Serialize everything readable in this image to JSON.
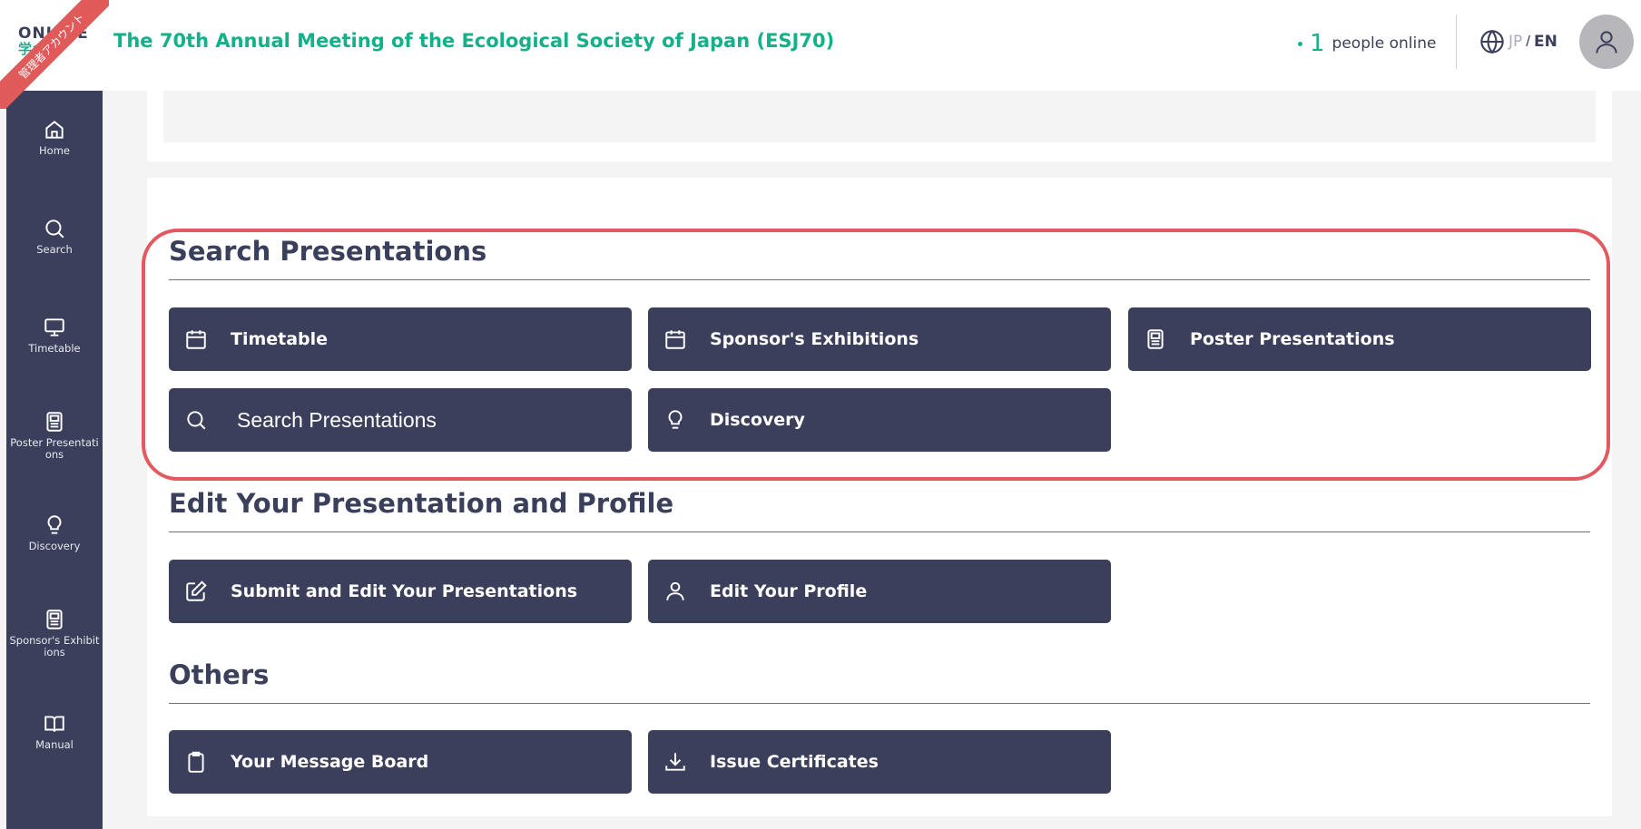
{
  "header": {
    "logo_line1": "ONLINE",
    "logo_line2": "学会",
    "ribbon": "管理者アカウント",
    "title": "The 70th Annual Meeting of the Ecological Society of Japan (ESJ70)",
    "online_count": "1",
    "online_label": "people online",
    "lang_jp": "JP",
    "lang_sep": "/",
    "lang_en": "EN"
  },
  "sidebar": {
    "items": [
      {
        "label": "Home",
        "icon": "home-icon"
      },
      {
        "label": "Search",
        "icon": "search-icon"
      },
      {
        "label": "Timetable",
        "icon": "monitor-icon"
      },
      {
        "label": "Poster Presentations",
        "icon": "poster-icon"
      },
      {
        "label": "Discovery",
        "icon": "lightbulb-icon"
      },
      {
        "label": "Sponsor's Exhibitions",
        "icon": "poster-icon"
      },
      {
        "label": "Manual",
        "icon": "book-icon"
      }
    ]
  },
  "sections": {
    "search": {
      "title": "Search Presentations",
      "buttons": [
        "Timetable",
        "Sponsor's Exhibitions",
        "Poster Presentations",
        "Search Presentations",
        "Discovery"
      ]
    },
    "edit": {
      "title": "Edit Your Presentation and Profile",
      "buttons": [
        "Submit and Edit Your Presentations",
        "Edit Your Profile"
      ]
    },
    "others": {
      "title": "Others",
      "buttons": [
        "Your Message Board",
        "Issue Certificates"
      ]
    }
  },
  "colors": {
    "accent": "#14b08a",
    "navy": "#3b3f5c",
    "highlight": "#e25a5f"
  }
}
